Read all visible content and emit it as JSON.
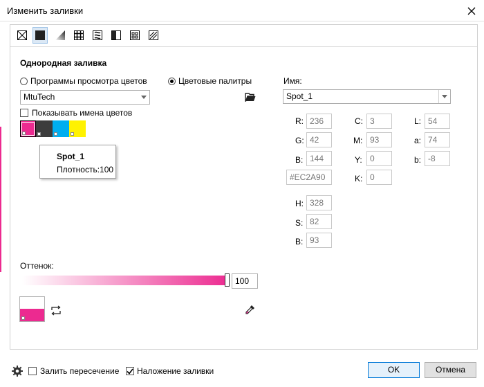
{
  "dialog": {
    "title": "Изменить заливки"
  },
  "fill": {
    "section_title": "Однородная заливка",
    "mode_viewers_label": "Программы просмотра цветов",
    "mode_palettes_label": "Цветовые палитры",
    "palette_name": "MtuTech",
    "show_names_label": "Показывать имена цветов",
    "swatches": [
      {
        "color": "#ec2a90"
      },
      {
        "color": "#3c3c3c"
      },
      {
        "color": "#00aeef"
      },
      {
        "color": "#fff200"
      }
    ],
    "tooltip": {
      "name": "Spot_1",
      "density": "Плотность:100"
    }
  },
  "color": {
    "name_label": "Имя:",
    "name_value": "Spot_1",
    "R": "236",
    "G": "42",
    "B": "144",
    "hex": "#EC2A90",
    "C": "3",
    "M": "93",
    "Y": "0",
    "K": "0",
    "L": "54",
    "a": "74",
    "b": "-8",
    "H": "328",
    "S": "82",
    "Bv": "93",
    "labels": {
      "R": "R:",
      "G": "G:",
      "B": "B:",
      "C": "C:",
      "M": "M:",
      "Y": "Y:",
      "K": "K:",
      "L": "L:",
      "a": "a:",
      "b": "b:",
      "H": "H:",
      "S": "S:",
      "Bv": "B:"
    }
  },
  "tint": {
    "label": "Оттенок:",
    "value": "100"
  },
  "footer": {
    "overprint_fill_label": "Залить пересечение",
    "overprint_fill_checked": false,
    "fill_overprint_label": "Наложение заливки",
    "fill_overprint_checked": true,
    "ok_label": "OK",
    "cancel_label": "Отмена"
  },
  "colors": {
    "accent": "#ec2a90",
    "selection": "#dbe8f5",
    "primary_border": "#0078d7"
  }
}
